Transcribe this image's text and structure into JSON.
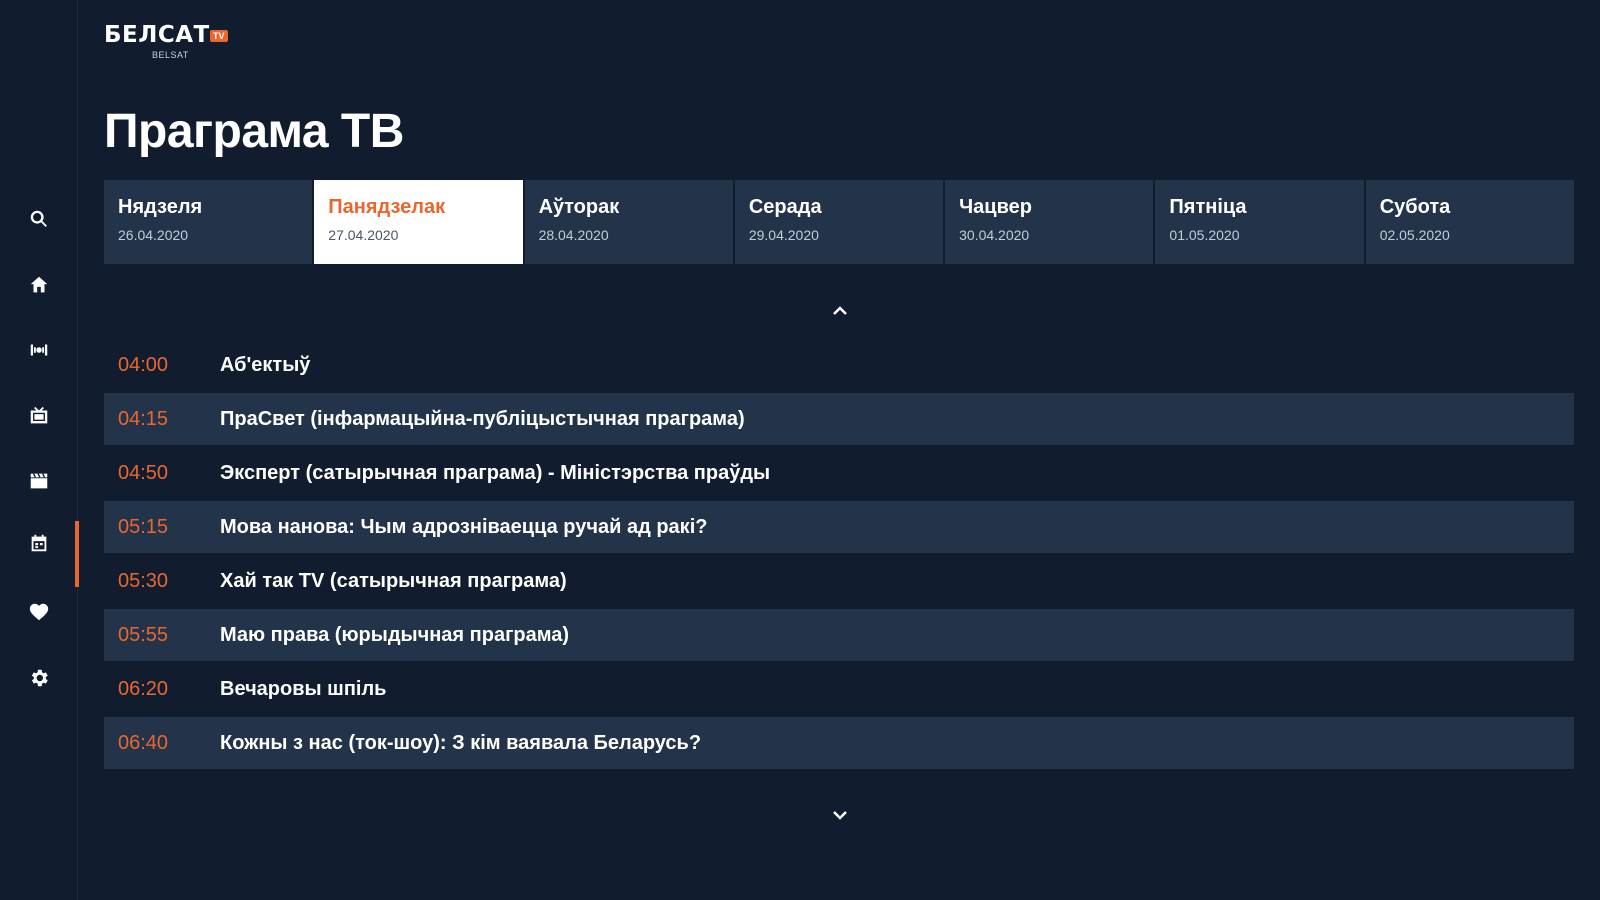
{
  "logo": {
    "main": "БЕЛСАТ",
    "badge": "TV",
    "sub": "BELSAT"
  },
  "page_title": "Праграма ТВ",
  "sidebar": {
    "items": [
      {
        "icon": "search-icon"
      },
      {
        "icon": "home-icon"
      },
      {
        "icon": "live-broadcast-icon"
      },
      {
        "icon": "tv-icon"
      },
      {
        "icon": "clapperboard-icon"
      },
      {
        "icon": "calendar-icon",
        "active": true
      },
      {
        "icon": "heart-icon"
      },
      {
        "icon": "gear-icon"
      }
    ]
  },
  "days": [
    {
      "day": "Нядзеля",
      "date": "26.04.2020"
    },
    {
      "day": "Панядзелак",
      "date": "27.04.2020",
      "active": true
    },
    {
      "day": "Аўторак",
      "date": "28.04.2020"
    },
    {
      "day": "Серада",
      "date": "29.04.2020"
    },
    {
      "day": "Чацвер",
      "date": "30.04.2020"
    },
    {
      "day": "Пятніца",
      "date": "01.05.2020"
    },
    {
      "day": "Субота",
      "date": "02.05.2020"
    }
  ],
  "schedule": [
    {
      "time": "04:00",
      "title": "Аб'ектыў"
    },
    {
      "time": "04:15",
      "title": "ПраСвет (інфармацыйна-публіцыстычная праграма)"
    },
    {
      "time": "04:50",
      "title": "Эксперт (сатырычная праграма) - Міністэрства праўды"
    },
    {
      "time": "05:15",
      "title": "Мова нанова: Чым адрозніваецца ручай ад ракі?"
    },
    {
      "time": "05:30",
      "title": "Хай так TV (сатырычная праграма)"
    },
    {
      "time": "05:55",
      "title": "Маю права (юрыдычная праграма)"
    },
    {
      "time": "06:20",
      "title": "Вечаровы шпіль"
    },
    {
      "time": "06:40",
      "title": "Кожны з нас (ток-шоу): З кім ваявала Беларусь?"
    }
  ],
  "colors": {
    "accent": "#e8672f",
    "background": "#111d2e",
    "row_alt": "#22334a"
  }
}
